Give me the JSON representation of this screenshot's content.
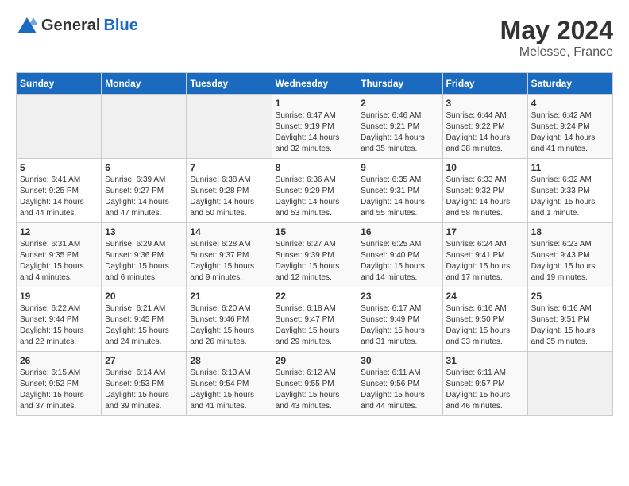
{
  "header": {
    "logo_general": "General",
    "logo_blue": "Blue",
    "month": "May 2024",
    "location": "Melesse, France"
  },
  "weekdays": [
    "Sunday",
    "Monday",
    "Tuesday",
    "Wednesday",
    "Thursday",
    "Friday",
    "Saturday"
  ],
  "weeks": [
    [
      {
        "day": "",
        "sunrise": "",
        "sunset": "",
        "daylight": ""
      },
      {
        "day": "",
        "sunrise": "",
        "sunset": "",
        "daylight": ""
      },
      {
        "day": "",
        "sunrise": "",
        "sunset": "",
        "daylight": ""
      },
      {
        "day": "1",
        "sunrise": "Sunrise: 6:47 AM",
        "sunset": "Sunset: 9:19 PM",
        "daylight": "Daylight: 14 hours and 32 minutes."
      },
      {
        "day": "2",
        "sunrise": "Sunrise: 6:46 AM",
        "sunset": "Sunset: 9:21 PM",
        "daylight": "Daylight: 14 hours and 35 minutes."
      },
      {
        "day": "3",
        "sunrise": "Sunrise: 6:44 AM",
        "sunset": "Sunset: 9:22 PM",
        "daylight": "Daylight: 14 hours and 38 minutes."
      },
      {
        "day": "4",
        "sunrise": "Sunrise: 6:42 AM",
        "sunset": "Sunset: 9:24 PM",
        "daylight": "Daylight: 14 hours and 41 minutes."
      }
    ],
    [
      {
        "day": "5",
        "sunrise": "Sunrise: 6:41 AM",
        "sunset": "Sunset: 9:25 PM",
        "daylight": "Daylight: 14 hours and 44 minutes."
      },
      {
        "day": "6",
        "sunrise": "Sunrise: 6:39 AM",
        "sunset": "Sunset: 9:27 PM",
        "daylight": "Daylight: 14 hours and 47 minutes."
      },
      {
        "day": "7",
        "sunrise": "Sunrise: 6:38 AM",
        "sunset": "Sunset: 9:28 PM",
        "daylight": "Daylight: 14 hours and 50 minutes."
      },
      {
        "day": "8",
        "sunrise": "Sunrise: 6:36 AM",
        "sunset": "Sunset: 9:29 PM",
        "daylight": "Daylight: 14 hours and 53 minutes."
      },
      {
        "day": "9",
        "sunrise": "Sunrise: 6:35 AM",
        "sunset": "Sunset: 9:31 PM",
        "daylight": "Daylight: 14 hours and 55 minutes."
      },
      {
        "day": "10",
        "sunrise": "Sunrise: 6:33 AM",
        "sunset": "Sunset: 9:32 PM",
        "daylight": "Daylight: 14 hours and 58 minutes."
      },
      {
        "day": "11",
        "sunrise": "Sunrise: 6:32 AM",
        "sunset": "Sunset: 9:33 PM",
        "daylight": "Daylight: 15 hours and 1 minute."
      }
    ],
    [
      {
        "day": "12",
        "sunrise": "Sunrise: 6:31 AM",
        "sunset": "Sunset: 9:35 PM",
        "daylight": "Daylight: 15 hours and 4 minutes."
      },
      {
        "day": "13",
        "sunrise": "Sunrise: 6:29 AM",
        "sunset": "Sunset: 9:36 PM",
        "daylight": "Daylight: 15 hours and 6 minutes."
      },
      {
        "day": "14",
        "sunrise": "Sunrise: 6:28 AM",
        "sunset": "Sunset: 9:37 PM",
        "daylight": "Daylight: 15 hours and 9 minutes."
      },
      {
        "day": "15",
        "sunrise": "Sunrise: 6:27 AM",
        "sunset": "Sunset: 9:39 PM",
        "daylight": "Daylight: 15 hours and 12 minutes."
      },
      {
        "day": "16",
        "sunrise": "Sunrise: 6:25 AM",
        "sunset": "Sunset: 9:40 PM",
        "daylight": "Daylight: 15 hours and 14 minutes."
      },
      {
        "day": "17",
        "sunrise": "Sunrise: 6:24 AM",
        "sunset": "Sunset: 9:41 PM",
        "daylight": "Daylight: 15 hours and 17 minutes."
      },
      {
        "day": "18",
        "sunrise": "Sunrise: 6:23 AM",
        "sunset": "Sunset: 9:43 PM",
        "daylight": "Daylight: 15 hours and 19 minutes."
      }
    ],
    [
      {
        "day": "19",
        "sunrise": "Sunrise: 6:22 AM",
        "sunset": "Sunset: 9:44 PM",
        "daylight": "Daylight: 15 hours and 22 minutes."
      },
      {
        "day": "20",
        "sunrise": "Sunrise: 6:21 AM",
        "sunset": "Sunset: 9:45 PM",
        "daylight": "Daylight: 15 hours and 24 minutes."
      },
      {
        "day": "21",
        "sunrise": "Sunrise: 6:20 AM",
        "sunset": "Sunset: 9:46 PM",
        "daylight": "Daylight: 15 hours and 26 minutes."
      },
      {
        "day": "22",
        "sunrise": "Sunrise: 6:18 AM",
        "sunset": "Sunset: 9:47 PM",
        "daylight": "Daylight: 15 hours and 29 minutes."
      },
      {
        "day": "23",
        "sunrise": "Sunrise: 6:17 AM",
        "sunset": "Sunset: 9:49 PM",
        "daylight": "Daylight: 15 hours and 31 minutes."
      },
      {
        "day": "24",
        "sunrise": "Sunrise: 6:16 AM",
        "sunset": "Sunset: 9:50 PM",
        "daylight": "Daylight: 15 hours and 33 minutes."
      },
      {
        "day": "25",
        "sunrise": "Sunrise: 6:16 AM",
        "sunset": "Sunset: 9:51 PM",
        "daylight": "Daylight: 15 hours and 35 minutes."
      }
    ],
    [
      {
        "day": "26",
        "sunrise": "Sunrise: 6:15 AM",
        "sunset": "Sunset: 9:52 PM",
        "daylight": "Daylight: 15 hours and 37 minutes."
      },
      {
        "day": "27",
        "sunrise": "Sunrise: 6:14 AM",
        "sunset": "Sunset: 9:53 PM",
        "daylight": "Daylight: 15 hours and 39 minutes."
      },
      {
        "day": "28",
        "sunrise": "Sunrise: 6:13 AM",
        "sunset": "Sunset: 9:54 PM",
        "daylight": "Daylight: 15 hours and 41 minutes."
      },
      {
        "day": "29",
        "sunrise": "Sunrise: 6:12 AM",
        "sunset": "Sunset: 9:55 PM",
        "daylight": "Daylight: 15 hours and 43 minutes."
      },
      {
        "day": "30",
        "sunrise": "Sunrise: 6:11 AM",
        "sunset": "Sunset: 9:56 PM",
        "daylight": "Daylight: 15 hours and 44 minutes."
      },
      {
        "day": "31",
        "sunrise": "Sunrise: 6:11 AM",
        "sunset": "Sunset: 9:57 PM",
        "daylight": "Daylight: 15 hours and 46 minutes."
      },
      {
        "day": "",
        "sunrise": "",
        "sunset": "",
        "daylight": ""
      }
    ]
  ]
}
